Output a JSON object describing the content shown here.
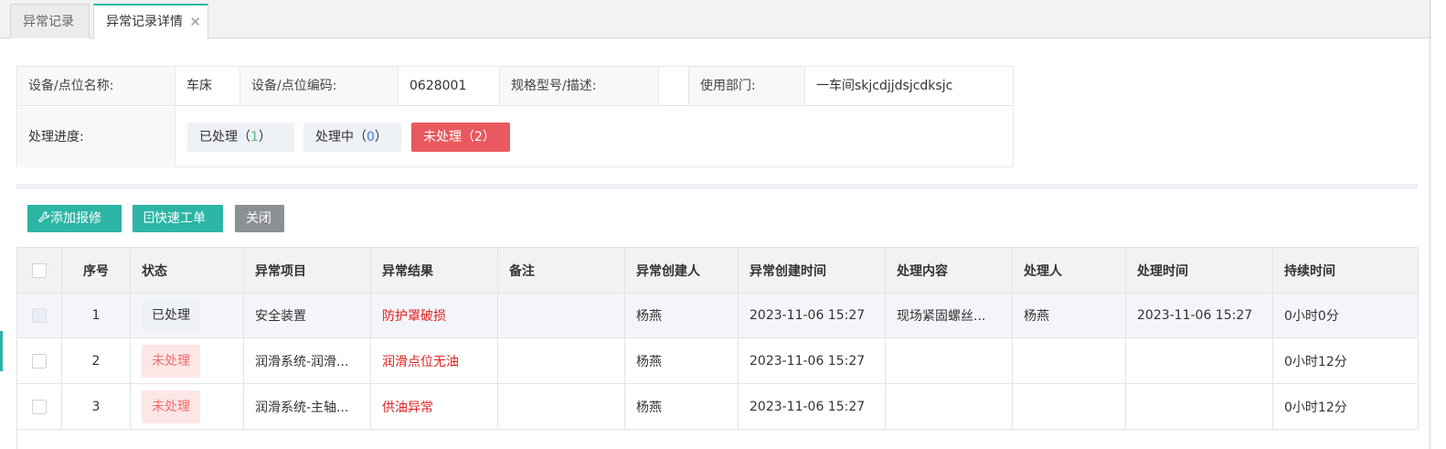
{
  "tabs": [
    {
      "label": "异常记录"
    },
    {
      "label": "异常记录详情",
      "close": "✕"
    }
  ],
  "info": {
    "device_name_label": "设备/点位名称:",
    "device_name": "车床",
    "device_code_label": "设备/点位编码:",
    "device_code": "0628001",
    "spec_label": "规格型号/描述:",
    "spec": "",
    "dept_label": "使用部门:",
    "dept": "一车间skjcdjjdsjcdksjc",
    "progress_label": "处理进度:",
    "progress": {
      "done_label": "已处理",
      "done_count": "1",
      "inprogress_label": "处理中",
      "inprogress_count": "0",
      "pending_label": "未处理",
      "pending_count": "2"
    }
  },
  "toolbar": {
    "add_repair": "添加报修",
    "quick_order": "快速工单",
    "close": "关闭"
  },
  "table": {
    "headers": [
      "序号",
      "状态",
      "异常项目",
      "异常结果",
      "备注",
      "异常创建人",
      "异常创建时间",
      "处理内容",
      "处理人",
      "处理时间",
      "持续时间"
    ],
    "rows": [
      {
        "no": "1",
        "status": "已处理",
        "item": "安全装置",
        "result": "防护罩破损",
        "remark": "",
        "creator": "杨燕",
        "created": "2023-11-06 15:27",
        "content": "现场紧固螺丝...",
        "handler": "杨燕",
        "handled": "2023-11-06 15:27",
        "duration": "0小时0分"
      },
      {
        "no": "2",
        "status": "未处理",
        "item": "润滑系统-润滑...",
        "result": "润滑点位无油",
        "remark": "",
        "creator": "杨燕",
        "created": "2023-11-06 15:27",
        "content": "",
        "handler": "",
        "handled": "",
        "duration": "0小时12分"
      },
      {
        "no": "3",
        "status": "未处理",
        "item": "润滑系统-主轴...",
        "result": "供油异常",
        "remark": "",
        "creator": "杨燕",
        "created": "2023-11-06 15:27",
        "content": "",
        "handler": "",
        "handled": "",
        "duration": "0小时12分"
      }
    ]
  },
  "colors": {
    "accent": "#2cb5a5",
    "danger": "#e85a5f",
    "result_red": "#e02020"
  }
}
